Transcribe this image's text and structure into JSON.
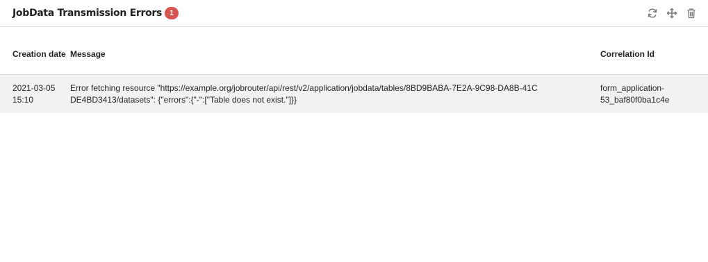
{
  "widget": {
    "title": "JobData Transmission Errors",
    "badge_count": "1",
    "badge_color": "#d9534f",
    "toolbar": {
      "refresh_icon": "refresh-icon",
      "move_icon": "move-icon",
      "delete_icon": "trash-icon"
    }
  },
  "table": {
    "columns": {
      "creation_date": "Creation date",
      "message": "Message",
      "correlation_id": "Correlation Id"
    },
    "rows": [
      {
        "creation_date": "2021-03-05 15:10",
        "message": "Error fetching resource \"https://example.org/jobrouter/api/rest/v2/application/jobdata/tables/8BD9BABA-7E2A-9C98-DA8B-41CDE4BD3413/datasets\": {\"errors\":{\"-\":[\"Table does not exist.\"]}}",
        "correlation_id": "form_application-53_baf80f0ba1c4e"
      }
    ]
  }
}
